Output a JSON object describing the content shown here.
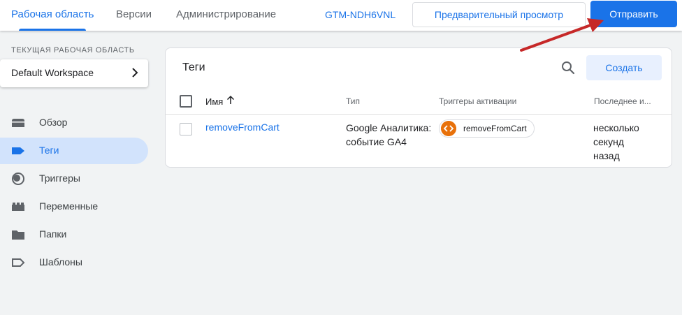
{
  "topbar": {
    "tabs": [
      {
        "label": "Рабочая область",
        "active": true
      },
      {
        "label": "Версии",
        "active": false
      },
      {
        "label": "Администрирование",
        "active": false
      }
    ],
    "container_id": "GTM-NDH6VNL",
    "preview_label": "Предварительный просмотр",
    "submit_label": "Отправить"
  },
  "sidebar": {
    "workspace_label": "ТЕКУЩАЯ РАБОЧАЯ ОБЛАСТЬ",
    "workspace_name": "Default Workspace",
    "items": [
      {
        "label": "Обзор",
        "icon": "overview-icon",
        "active": false
      },
      {
        "label": "Теги",
        "icon": "tag-icon",
        "active": true
      },
      {
        "label": "Триггеры",
        "icon": "trigger-icon",
        "active": false
      },
      {
        "label": "Переменные",
        "icon": "variables-icon",
        "active": false
      },
      {
        "label": "Папки",
        "icon": "folder-icon",
        "active": false
      },
      {
        "label": "Шаблоны",
        "icon": "template-icon",
        "active": false
      }
    ]
  },
  "main": {
    "title": "Теги",
    "create_label": "Создать",
    "columns": {
      "name": "Имя",
      "type": "Тип",
      "triggers": "Триггеры активации",
      "last_edited": "Последнее и..."
    },
    "rows": [
      {
        "name": "removeFromCart",
        "type_line1": "Google Аналитика:",
        "type_line2": "событие GA4",
        "trigger": "removeFromCart",
        "edited_line1": "несколько",
        "edited_line2": "секунд",
        "edited_line3": "назад"
      }
    ]
  },
  "colors": {
    "accent": "#1a73e8",
    "active_nav_bg": "#d2e3fc",
    "trigger_chip_icon": "#e8710a",
    "annotation_arrow": "#c62828"
  }
}
